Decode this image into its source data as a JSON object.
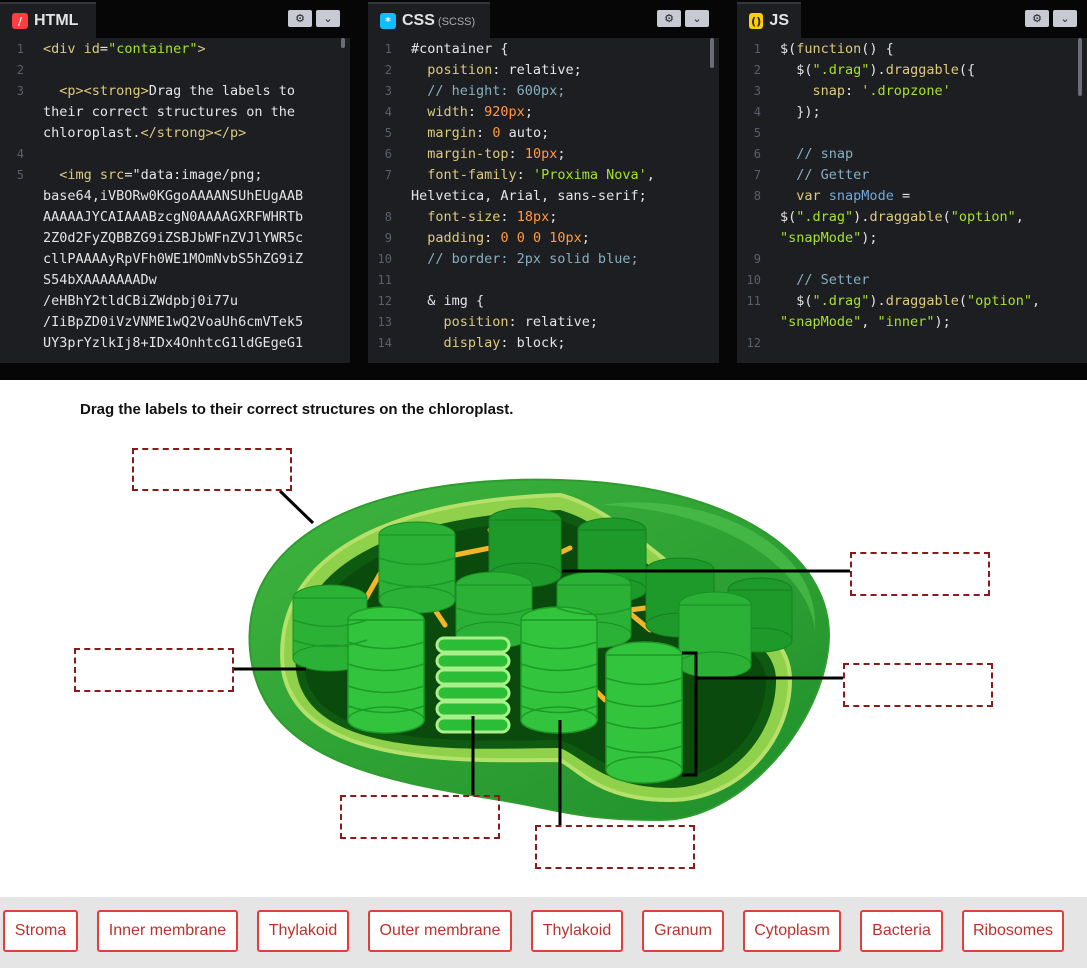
{
  "editors": {
    "html": {
      "title": "HTML",
      "code": [
        {
          "n": "1",
          "text": "<div id=\"container\">"
        },
        {
          "n": "2",
          "text": ""
        },
        {
          "n": "3",
          "text": "  <p><strong>Drag the labels to"
        },
        {
          "n": "",
          "text": "their correct structures on the"
        },
        {
          "n": "",
          "text": "chloroplast.</strong></p>"
        },
        {
          "n": "4",
          "text": ""
        },
        {
          "n": "5",
          "text": "  <img src=\"data:image/png;"
        },
        {
          "n": "",
          "text": "base64,iVBORw0KGgoAAAANSUhEUgAAB"
        },
        {
          "n": "",
          "text": "AAAAAJYCAIAAABzcgN0AAAAGXRFWHRTb"
        },
        {
          "n": "",
          "text": "2Z0d2FyZQBBZG9iZSBJbWFnZVJlYWR5c"
        },
        {
          "n": "",
          "text": "cllPAAAAyRpVFh0WE1MOmNvbS5hZG9iZ"
        },
        {
          "n": "",
          "text": "S54bXAAAAAAADw"
        },
        {
          "n": "",
          "text": "/eHBhY2tldCBiZWdpbj0i77u"
        },
        {
          "n": "",
          "text": "/IiBpZD0iVzVNME1wQ2VoaUh6cmVTek5"
        },
        {
          "n": "",
          "text": "UY3prYzlkIj8+IDx4OnhtcG1ldGEgeG1"
        }
      ]
    },
    "css": {
      "title": "CSS",
      "subtitle": "(SCSS)",
      "code": [
        {
          "n": "1",
          "text": "#container {"
        },
        {
          "n": "2",
          "text": "  position: relative;"
        },
        {
          "n": "3",
          "text": "  // height: 600px;"
        },
        {
          "n": "4",
          "text": "  width: 920px;"
        },
        {
          "n": "5",
          "text": "  margin: 0 auto;"
        },
        {
          "n": "6",
          "text": "  margin-top: 10px;"
        },
        {
          "n": "7",
          "text": "  font-family: 'Proxima Nova',"
        },
        {
          "n": "",
          "text": "Helvetica, Arial, sans-serif;"
        },
        {
          "n": "8",
          "text": "  font-size: 18px;"
        },
        {
          "n": "9",
          "text": "  padding: 0 0 0 10px;"
        },
        {
          "n": "10",
          "text": "  // border: 2px solid blue;"
        },
        {
          "n": "11",
          "text": ""
        },
        {
          "n": "12",
          "text": "  & img {"
        },
        {
          "n": "13",
          "text": "    position: relative;"
        },
        {
          "n": "14",
          "text": "    display: block;"
        }
      ]
    },
    "js": {
      "title": "JS",
      "code": [
        {
          "n": "1",
          "text": "$(function() {"
        },
        {
          "n": "2",
          "text": "  $(\".drag\").draggable({"
        },
        {
          "n": "3",
          "text": "    snap: '.dropzone'"
        },
        {
          "n": "4",
          "text": "  });"
        },
        {
          "n": "5",
          "text": ""
        },
        {
          "n": "6",
          "text": "  // snap"
        },
        {
          "n": "7",
          "text": "  // Getter"
        },
        {
          "n": "8",
          "text": "  var snapMode ="
        },
        {
          "n": "",
          "text": "$(\".drag\").draggable(\"option\","
        },
        {
          "n": "",
          "text": "\"snapMode\");"
        },
        {
          "n": "9",
          "text": ""
        },
        {
          "n": "10",
          "text": "  // Setter"
        },
        {
          "n": "11",
          "text": "  $(\".drag\").draggable(\"option\","
        },
        {
          "n": "",
          "text": "\"snapMode\", \"inner\");"
        },
        {
          "n": "12",
          "text": ""
        }
      ]
    },
    "icons": {
      "settings": "gear-icon",
      "collapse": "chevron-down-icon"
    }
  },
  "result": {
    "instruction": "Drag the labels to their correct structures on the chloroplast.",
    "labels": [
      "Stroma",
      "Inner membrane",
      "Thylakoid",
      "Outer membrane",
      "Thylakoid",
      "Granum",
      "Cytoplasm",
      "Bacteria",
      "Ribosomes"
    ]
  },
  "colors": {
    "html_icon": "#ff3c41",
    "css_icon": "#0ebeff",
    "js_icon": "#fcd000",
    "dropzone_border": "#8b1a1a",
    "label_border": "#e0403a",
    "label_text": "#c0302a"
  }
}
